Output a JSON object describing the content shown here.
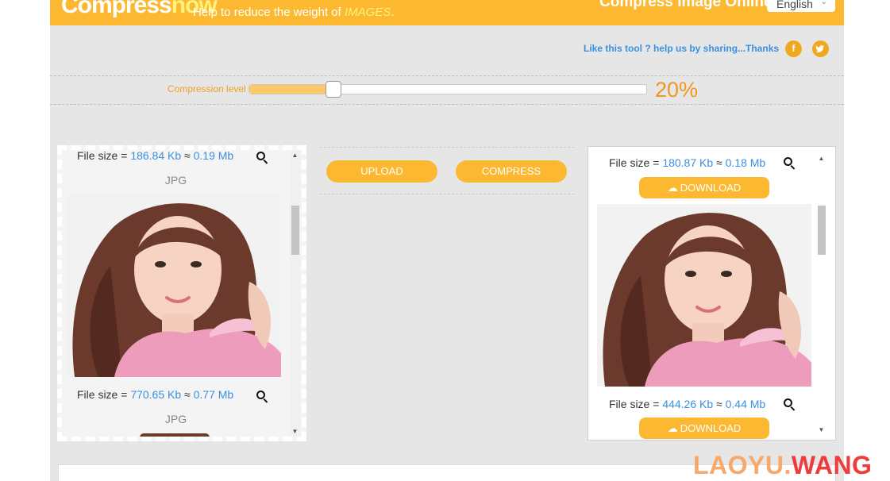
{
  "header": {
    "logo_main": "Compress",
    "logo_accent": "now",
    "tagline_prefix": "Help to reduce the weight of ",
    "tagline_em": "IMAGES",
    "tagline_suffix": ".",
    "site_title": "Compress Image Online",
    "language": "English"
  },
  "share": {
    "text": "Like this tool ? help us by sharing...Thanks",
    "facebook_glyph": "f",
    "twitter_glyph": "t"
  },
  "compression": {
    "label": "Compression level",
    "value_percent": 20,
    "value_label": "20%"
  },
  "actions": {
    "upload": "UPLOAD",
    "compress": "COMPRESS"
  },
  "source_panel": {
    "items": [
      {
        "prefix": "File size = ",
        "kb": "186.84 Kb",
        "approx": " ≈ ",
        "mb": "0.19 Mb",
        "format": "JPG"
      },
      {
        "prefix": "File size = ",
        "kb": "770.65 Kb",
        "approx": " ≈ ",
        "mb": "0.77 Mb",
        "format": "JPG"
      }
    ]
  },
  "result_panel": {
    "download_label": "DOWNLOAD",
    "items": [
      {
        "prefix": "File size = ",
        "kb": "180.87 Kb",
        "approx": " ≈ ",
        "mb": "0.18 Mb"
      },
      {
        "prefix": "File size = ",
        "kb": "444.26 Kb",
        "approx": " ≈ ",
        "mb": "0.44 Mb"
      }
    ]
  },
  "watermark": {
    "part1": "LAOYU.",
    "part2": "WANG"
  },
  "colors": {
    "accent": "#fbb830",
    "link_blue": "#3b8fe0",
    "percent_orange": "#f09820"
  }
}
